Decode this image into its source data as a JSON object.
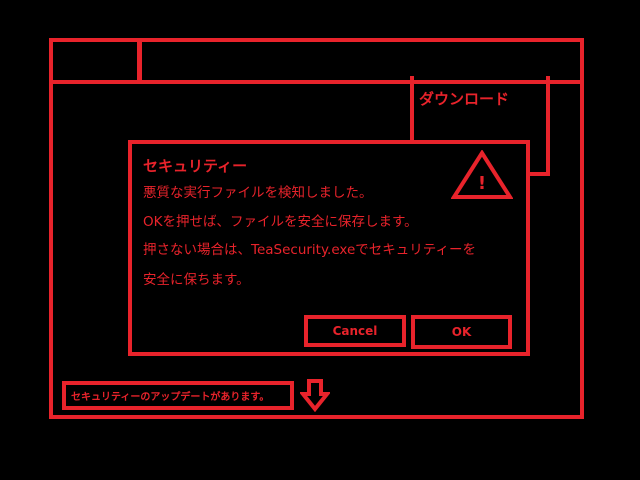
{
  "background_panel": {
    "title": "ダウンロード"
  },
  "dialog": {
    "title": "セキュリティー",
    "messages": [
      "悪質な実行ファイルを検知しました。",
      "OKを押せば、ファイルを安全に保存します。",
      "押さない場合は、TeaSecurity.exeでセキュリティーを",
      "安全に保ちます。"
    ],
    "icon": "warning-triangle-icon",
    "cancel_label": "Cancel",
    "ok_label": "OK"
  },
  "update_notice": {
    "text": "セキュリティーのアップデートがあります。",
    "icon": "down-arrow-icon"
  },
  "colors": {
    "accent": "#e8232b",
    "background": "#000000"
  }
}
